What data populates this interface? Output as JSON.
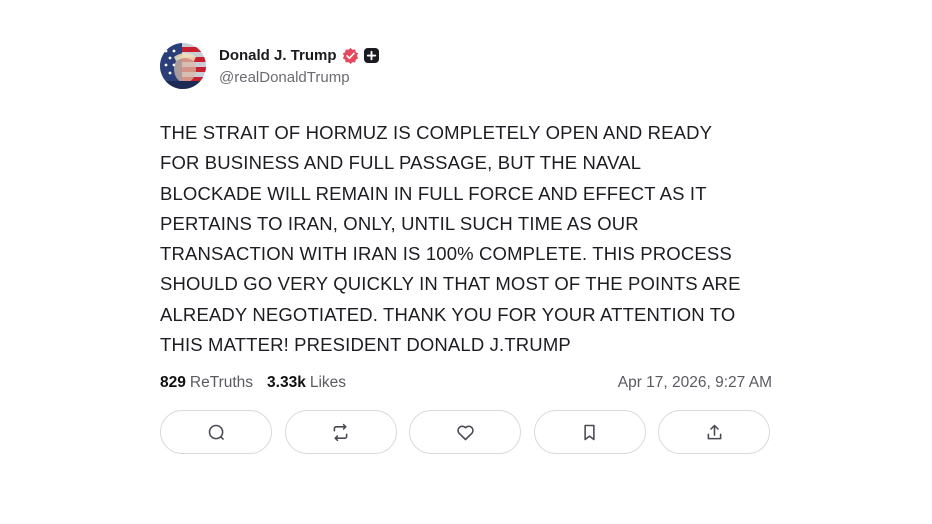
{
  "post": {
    "author": {
      "display_name": "Donald J. Trump",
      "handle": "@realDonaldTrump",
      "avatar_icon": "flag-portrait-avatar",
      "verified_icon": "verified-badge-icon",
      "verified_color": "#e5495c",
      "plus_icon": "plus-badge-icon"
    },
    "text": "THE STRAIT OF HORMUZ IS COMPLETELY OPEN AND READY\nFOR BUSINESS AND FULL PASSAGE, BUT THE NAVAL\nBLOCKADE WILL REMAIN IN FULL FORCE AND EFFECT AS IT\nPERTAINS TO IRAN, ONLY, UNTIL SUCH TIME AS OUR\nTRANSACTION WITH IRAN IS 100% COMPLETE. THIS PROCESS\nSHOULD GO VERY QUICKLY IN THAT MOST OF THE POINTS ARE\nALREADY NEGOTIATED. THANK YOU FOR YOUR ATTENTION TO\nTHIS MATTER! PRESIDENT DONALD J.TRUMP",
    "stats": {
      "retruths_count": "829",
      "retruths_label": "ReTruths",
      "likes_count": "3.33k",
      "likes_label": "Likes"
    },
    "timestamp": "Apr 17, 2026, 9:27 AM",
    "actions": [
      {
        "name": "reply",
        "icon": "search-bubble-icon"
      },
      {
        "name": "retruth",
        "icon": "repost-icon"
      },
      {
        "name": "like",
        "icon": "heart-icon"
      },
      {
        "name": "bookmark",
        "icon": "bookmark-icon"
      },
      {
        "name": "share",
        "icon": "share-icon"
      }
    ]
  }
}
